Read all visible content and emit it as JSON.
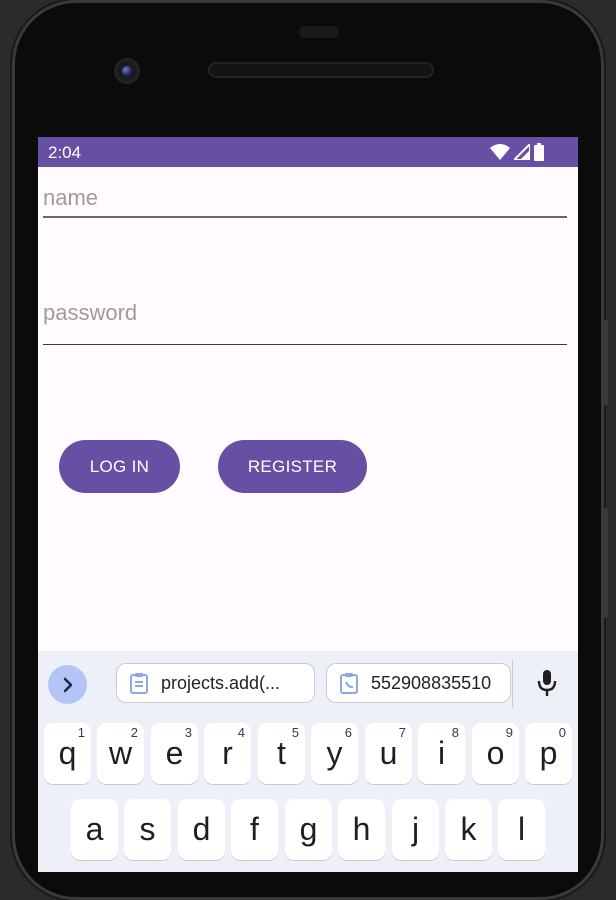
{
  "status_bar": {
    "time": "2:04"
  },
  "form": {
    "name_placeholder": "name",
    "password_placeholder": "password",
    "login_label": "LOG IN",
    "register_label": "REGISTER"
  },
  "keyboard": {
    "clipboard_chips": [
      "projects.add(...",
      "552908835510"
    ],
    "row1": [
      {
        "key": "q",
        "hint": "1"
      },
      {
        "key": "w",
        "hint": "2"
      },
      {
        "key": "e",
        "hint": "3"
      },
      {
        "key": "r",
        "hint": "4"
      },
      {
        "key": "t",
        "hint": "5"
      },
      {
        "key": "y",
        "hint": "6"
      },
      {
        "key": "u",
        "hint": "7"
      },
      {
        "key": "i",
        "hint": "8"
      },
      {
        "key": "o",
        "hint": "9"
      },
      {
        "key": "p",
        "hint": "0"
      }
    ],
    "row2": [
      "a",
      "s",
      "d",
      "f",
      "g",
      "h",
      "j",
      "k",
      "l"
    ]
  },
  "colors": {
    "primary": "#6750a4",
    "screen_bg": "#fffbfe",
    "keyboard_bg": "#eef0f7",
    "expand_button": "#b3c5f7"
  },
  "icons": {
    "status": [
      "wifi-icon",
      "cell-signal-icon",
      "battery-icon"
    ],
    "keyboard": [
      "chevron-right-icon",
      "clipboard-icon",
      "clipboard-paste-icon",
      "mic-icon"
    ]
  }
}
